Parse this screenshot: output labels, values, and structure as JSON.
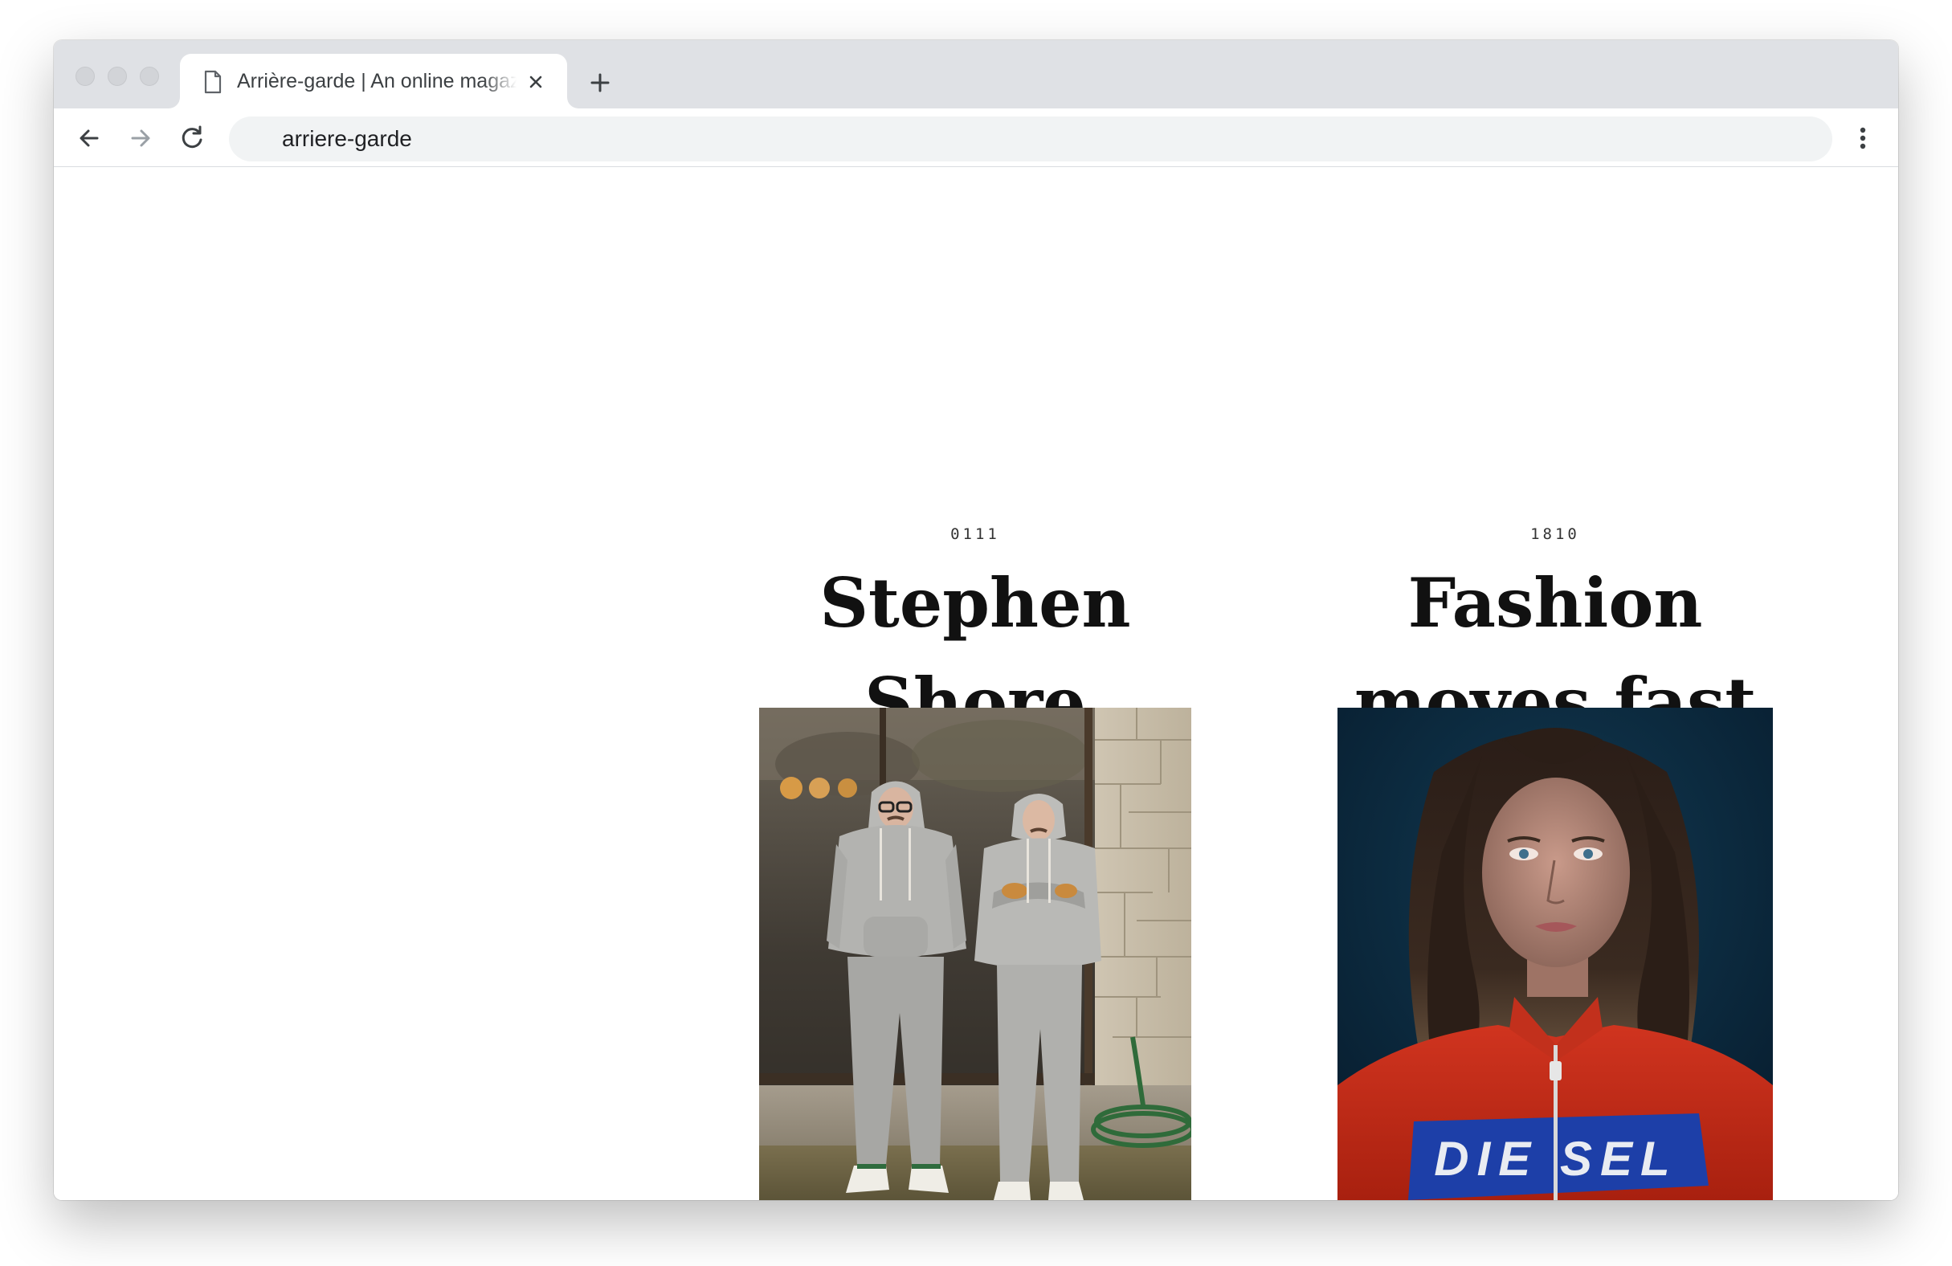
{
  "browser": {
    "tab": {
      "icon": "document-icon",
      "title": "Arrière-garde | An online magazine"
    },
    "new_tab_icon": "plus-icon",
    "toolbar": {
      "back_icon": "arrow-left-icon",
      "forward_icon": "arrow-right-icon",
      "reload_icon": "reload-icon",
      "address": "arriere-garde",
      "menu_icon": "vertical-dots-icon"
    }
  },
  "page": {
    "articles": [
      {
        "number": "0111",
        "title": "Stephen Shore",
        "image": "photo-two-men-in-grey-sweatsuits"
      },
      {
        "number": "1810",
        "title": "Fashion moves fast",
        "image": "photo-young-woman-in-red-diesel-jacket",
        "image_text": "DIESEL"
      }
    ]
  },
  "colors": {
    "tabstrip": "#dfe1e5",
    "omnibox": "#f1f3f4",
    "title_text": "#111111",
    "page_background": "#ffffff"
  }
}
